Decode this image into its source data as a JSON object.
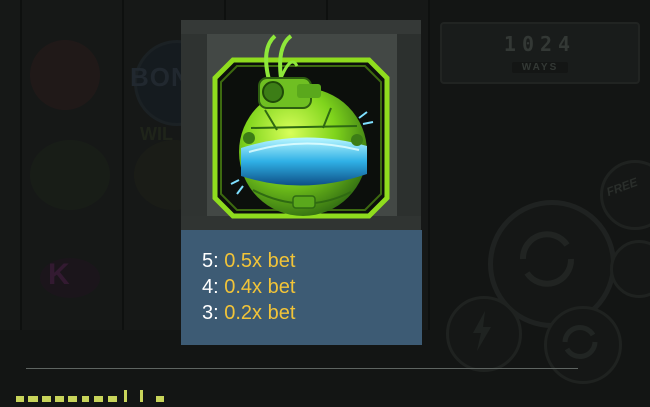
{
  "ways": {
    "number": "1024",
    "label": "WAYS"
  },
  "background_text": {
    "bonus": "BON",
    "wild": "WIL",
    "k": "K",
    "free": "FREE"
  },
  "symbol": {
    "icon": "green-robot-sphere-icon"
  },
  "paytable": {
    "rows": [
      {
        "count": "5:",
        "multiplier": "0.5x bet"
      },
      {
        "count": "4:",
        "multiplier": "0.4x bet"
      },
      {
        "count": "3:",
        "multiplier": "0.2x bet"
      }
    ]
  },
  "colors": {
    "multiplier": "#f2c438",
    "paytable_bg": "#3d5b74",
    "frame_green": "#8fdc1e"
  }
}
